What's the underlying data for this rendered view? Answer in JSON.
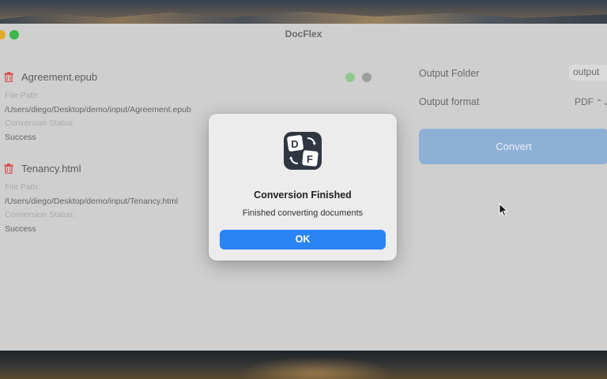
{
  "app": {
    "title": "DocFlex"
  },
  "files": [
    {
      "name": "Agreement.epub",
      "path_label": "File Path:",
      "path": "/Users/diego/Desktop/demo/input/Agreement.epub",
      "status_label": "Conversion Status:",
      "status": "Success"
    },
    {
      "name": "Tenancy.html",
      "path_label": "File Path:",
      "path": "/Users/diego/Desktop/demo/input/Tenancy.html",
      "status_label": "Conversion Status:",
      "status": "Success"
    }
  ],
  "settings": {
    "output_folder_label": "Output Folder",
    "output_folder_value": "output",
    "output_format_label": "Output format",
    "output_format_value": "PDF",
    "convert_label": "Convert"
  },
  "dialog": {
    "icon_letter_1": "D",
    "icon_letter_2": "F",
    "title": "Conversion Finished",
    "message": "Finished converting documents",
    "ok_label": "OK"
  },
  "colors": {
    "accent": "#2a84f5",
    "convert_disabled": "#8fb0d6",
    "trash": "#d9534f",
    "status_ok": "#8ec98e"
  }
}
